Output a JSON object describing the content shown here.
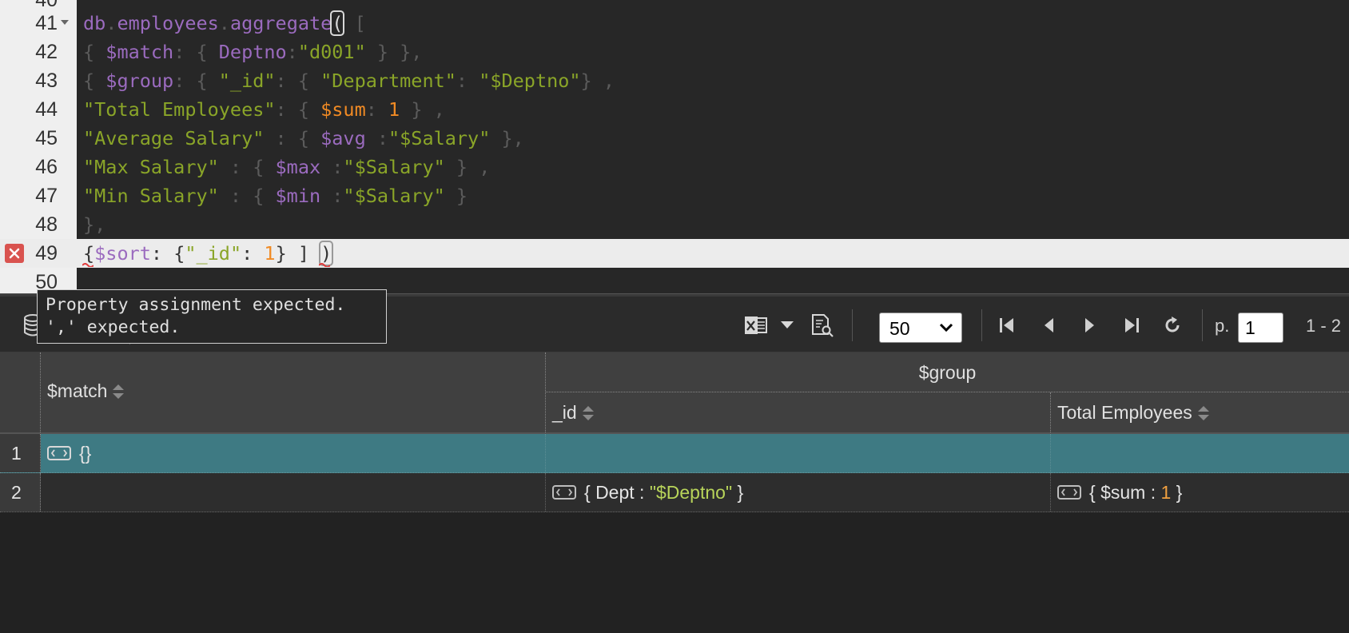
{
  "editor": {
    "lines": [
      {
        "no": "41",
        "fold": true
      },
      {
        "no": "42"
      },
      {
        "no": "43"
      },
      {
        "no": "44"
      },
      {
        "no": "45"
      },
      {
        "no": "46"
      },
      {
        "no": "47"
      },
      {
        "no": "48"
      },
      {
        "no": "49",
        "error": true
      },
      {
        "no": "50"
      }
    ],
    "code": {
      "l41": {
        "db": "db",
        "dot1": ".",
        "coll": "employees",
        "dot2": ".",
        "fn": "aggregate",
        "paren": "(",
        "rest": " ["
      },
      "l42": {
        "a": "{ ",
        "op": "$match",
        "b": ": { ",
        "field": "Deptno",
        "c": ":",
        "val": "\"d001\"",
        "d": " } },"
      },
      "l43": {
        "a": "{ ",
        "op": "$group",
        "b": ": { ",
        "key": "\"_id\"",
        "c": ": { ",
        "dk": "\"Department\"",
        "d": ": ",
        "dv": "\"$Deptno\"",
        "e": "} ,"
      },
      "l44": {
        "key": "\"Total Employees\"",
        "a": ": { ",
        "op": "$sum",
        "b": ": ",
        "num": "1",
        "c": " } ,"
      },
      "l45": {
        "key": "\"Average Salary\"",
        "a": " : { ",
        "op": "$avg",
        "b": " :",
        "val": "\"$Salary\"",
        "c": " },"
      },
      "l46": {
        "key": "\"Max Salary\"",
        "a": " : { ",
        "op": "$max",
        "b": " :",
        "val": "\"$Salary\"",
        "c": " } ,"
      },
      "l47": {
        "key": "\"Min Salary\"",
        "a": " : { ",
        "op": "$min",
        "b": " :",
        "val": "\"$Salary\"",
        "c": " }"
      },
      "l48": {
        "a": "},"
      },
      "l49": {
        "a": "{",
        "op": "$sort",
        "b": ": {",
        "key": "\"_id\"",
        "c": ": ",
        "num": "1",
        "d": "} ] ",
        "paren": ")"
      }
    }
  },
  "tooltip": {
    "line1": "Property assignment expected.",
    "line2": "',' expected."
  },
  "toolbar": {
    "page_size": "50",
    "page_label": "p.",
    "page_value": "1",
    "range": "1 - 2",
    "icons": [
      "database-icon",
      "excel-export-icon",
      "dropdown-caret-icon",
      "document-search-icon",
      "first-page-icon",
      "prev-page-icon",
      "next-page-icon",
      "last-page-icon",
      "refresh-icon"
    ]
  },
  "grid": {
    "headers": {
      "match": "$match",
      "group": "$group",
      "id": "_id",
      "total": "Total Employees"
    },
    "rows": [
      {
        "num": "1",
        "match": "{}",
        "id": "",
        "total": ""
      },
      {
        "num": "2",
        "match": "",
        "id": {
          "open": "{ Dept : ",
          "val": "\"$Deptno\"",
          "close": " }"
        },
        "total": {
          "open": "{ $sum : ",
          "val": "1",
          "close": " }"
        }
      }
    ]
  },
  "colors": {
    "selected_row": "#3e7a83",
    "keyword": "#9b6bbf",
    "string": "#8aa528",
    "number": "#f08a24",
    "error": "#d9534f"
  }
}
